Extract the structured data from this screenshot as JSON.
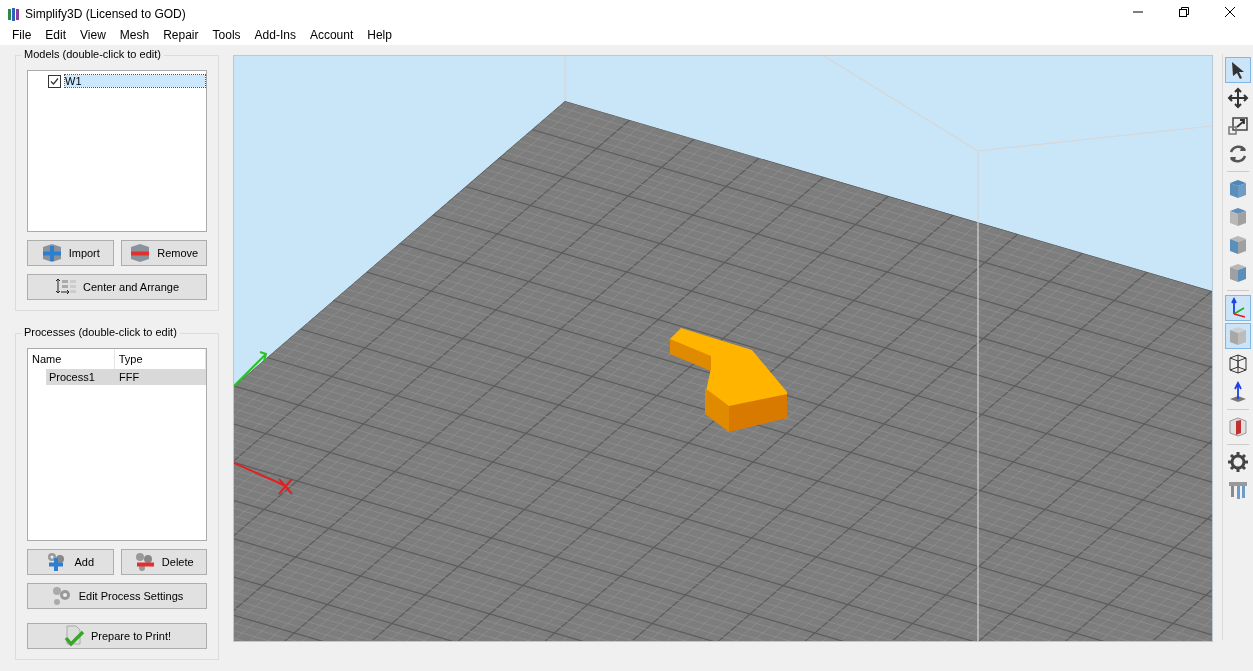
{
  "window": {
    "title": "Simplify3D (Licensed to GOD)"
  },
  "menu": [
    "File",
    "Edit",
    "View",
    "Mesh",
    "Repair",
    "Tools",
    "Add-Ins",
    "Account",
    "Help"
  ],
  "models": {
    "title": "Models (double-click to edit)",
    "items": [
      {
        "name": "W1",
        "checked": true,
        "selected": true
      }
    ],
    "buttons": [
      {
        "label": "Import",
        "kind": "import"
      },
      {
        "label": "Remove",
        "kind": "remove"
      },
      {
        "label": "Center and Arrange",
        "kind": "arrange"
      }
    ]
  },
  "processes": {
    "title": "Processes (double-click to edit)",
    "columns": [
      "Name",
      "Type"
    ],
    "rows": [
      {
        "name": "Process1",
        "type": "FFF",
        "selected": true
      }
    ],
    "buttons": [
      {
        "label": "Add",
        "kind": "add"
      },
      {
        "label": "Delete",
        "kind": "delete"
      },
      {
        "label": "Edit Process Settings",
        "kind": "settings"
      },
      {
        "label": "Prepare to Print!",
        "kind": "print"
      }
    ]
  },
  "toolbar": [
    {
      "kind": "select",
      "selected": true
    },
    {
      "kind": "move",
      "selected": false
    },
    {
      "kind": "scale",
      "selected": false
    },
    {
      "kind": "rotate",
      "selected": false
    },
    {
      "kind": "separator"
    },
    {
      "kind": "cube-top",
      "selected": false
    },
    {
      "kind": "cube-front",
      "selected": false
    },
    {
      "kind": "cube-left",
      "selected": false
    },
    {
      "kind": "cube-right",
      "selected": false
    },
    {
      "kind": "separator"
    },
    {
      "kind": "axes",
      "selected": true
    },
    {
      "kind": "solid",
      "selected": true
    },
    {
      "kind": "wireframe",
      "selected": false
    },
    {
      "kind": "normal",
      "selected": false
    },
    {
      "kind": "separator"
    },
    {
      "kind": "cross-section",
      "selected": false
    },
    {
      "kind": "separator"
    },
    {
      "kind": "gear",
      "selected": false
    },
    {
      "kind": "supports",
      "selected": false
    }
  ]
}
